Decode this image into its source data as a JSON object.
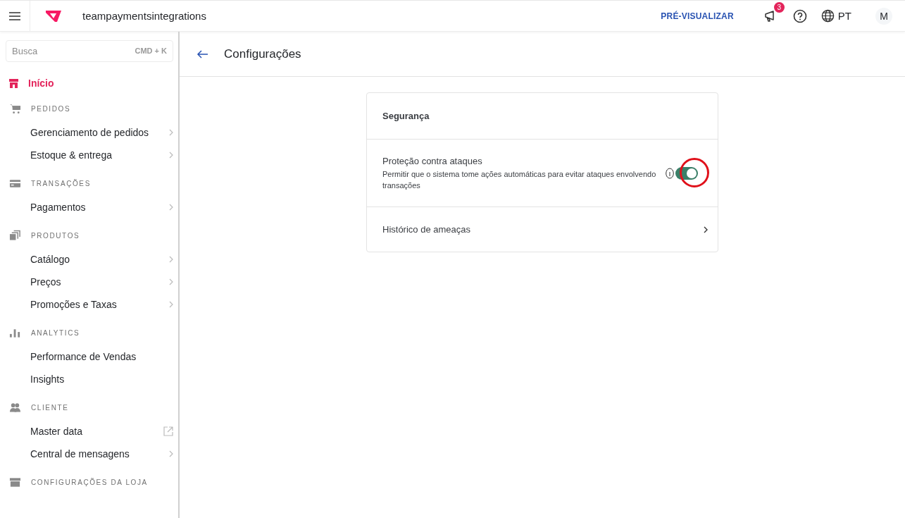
{
  "topbar": {
    "account": "teampaymentsintegrations",
    "preview": "PRÉ-VISUALIZAR",
    "notifications_badge": "3",
    "language": "PT",
    "avatar": "M"
  },
  "sidebar": {
    "search": {
      "placeholder": "Busca",
      "shortcut": "CMD + K"
    },
    "home": {
      "label": "Início",
      "selected": true
    },
    "sections": [
      {
        "title": "PEDIDOS",
        "items": [
          {
            "label": "Gerenciamento de pedidos",
            "kind": "submenu"
          },
          {
            "label": "Estoque & entrega",
            "kind": "submenu"
          }
        ]
      },
      {
        "title": "TRANSAÇÕES",
        "items": [
          {
            "label": "Pagamentos",
            "kind": "submenu"
          }
        ]
      },
      {
        "title": "PRODUTOS",
        "items": [
          {
            "label": "Catálogo",
            "kind": "submenu"
          },
          {
            "label": "Preços",
            "kind": "submenu"
          },
          {
            "label": "Promoções e Taxas",
            "kind": "submenu"
          }
        ]
      },
      {
        "title": "ANALYTICS",
        "items": [
          {
            "label": "Performance de Vendas",
            "kind": "plain"
          },
          {
            "label": "Insights",
            "kind": "plain"
          }
        ]
      },
      {
        "title": "CLIENTE",
        "items": [
          {
            "label": "Master data",
            "kind": "external"
          },
          {
            "label": "Central de mensagens",
            "kind": "submenu"
          }
        ]
      },
      {
        "title": "CONFIGURAÇÕES DA LOJA"
      }
    ]
  },
  "page": {
    "title": "Configurações",
    "card": {
      "title": "Segurança",
      "rows": [
        {
          "kind": "toggle",
          "label": "Proteção contra ataques",
          "description": "Permitir que o sistema tome ações automáticas para evitar ataques envolvendo transações",
          "on": true,
          "annotated": true
        },
        {
          "kind": "link",
          "label": "Histórico de ameaças"
        }
      ]
    }
  }
}
